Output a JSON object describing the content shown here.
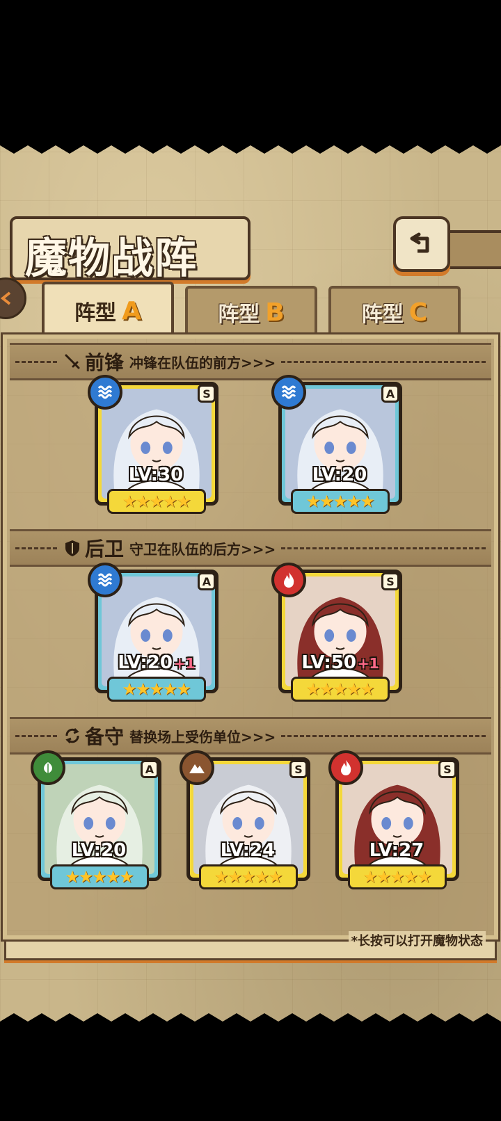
{
  "header": {
    "title": "魔物战阵"
  },
  "tabs": [
    {
      "label": "阵型",
      "letter": "A",
      "active": true
    },
    {
      "label": "阵型",
      "letter": "B",
      "active": false
    },
    {
      "label": "阵型",
      "letter": "C",
      "active": false
    }
  ],
  "sections": {
    "front": {
      "title": "前锋",
      "subtitle": "冲锋在队伍的前方>>>",
      "icon": "sword-icon"
    },
    "back": {
      "title": "后卫",
      "subtitle": "守卫在队伍的后方>>>",
      "icon": "shield-icon"
    },
    "reserve": {
      "title": "备守",
      "subtitle": "替换场上受伤单位>>>",
      "icon": "swap-icon"
    }
  },
  "monsters": {
    "front": [
      {
        "rank": "S",
        "element": "water",
        "level": "LV:30",
        "plus": "",
        "stars": 5
      },
      {
        "rank": "A",
        "element": "water",
        "level": "LV:20",
        "plus": "",
        "stars": 5
      }
    ],
    "back": [
      {
        "rank": "A",
        "element": "water",
        "level": "LV:20",
        "plus": "+1",
        "stars": 5
      },
      {
        "rank": "S",
        "element": "fire",
        "level": "LV:50",
        "plus": "+1",
        "stars": 5
      }
    ],
    "reserve": [
      {
        "rank": "A",
        "element": "nature",
        "level": "LV:20",
        "plus": "",
        "stars": 5
      },
      {
        "rank": "S",
        "element": "earth",
        "level": "LV:24",
        "plus": "",
        "stars": 5
      },
      {
        "rank": "S",
        "element": "fire",
        "level": "LV:27",
        "plus": "",
        "stars": 5
      }
    ]
  },
  "footer": {
    "hint": "*长按可以打开魔物状态"
  },
  "colors": {
    "rank_S": "#f4d83a",
    "rank_A": "#6fc7d8",
    "water": "#2f7ad2",
    "fire": "#d2322f",
    "nature": "#3f8c3a",
    "earth": "#8a5530",
    "accent": "#d27a2a"
  },
  "icons": {
    "back": "return-arrow-icon",
    "side": "chevron-left-icon",
    "star": "star-icon"
  }
}
